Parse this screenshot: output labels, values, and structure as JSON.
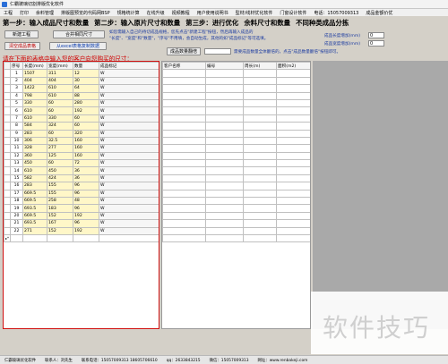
{
  "titlebar": {
    "title": "仁霸玻璃切割排版优化软件"
  },
  "menu": [
    "工程",
    "打印",
    "余料管理",
    "排版图预览的代码网BSP",
    "规格统计算",
    "在线升级",
    "视频教程",
    "用户使用说明书",
    "型材/线材优化软件",
    "门窗设计软件",
    "电话：15057009313",
    "成品金额价优"
  ],
  "steps": [
    "第一步：输入成品尺寸和数量",
    "第二步：输入原片尺寸和数量",
    "第三步：进行优化",
    "余料尺寸和数量",
    "不同种类成品分拣"
  ],
  "buttons": {
    "new_project": "新建工程",
    "merge_size": "合并相同尺寸",
    "clear_table": "清空成品表格",
    "import_excel": "从excel表格复制数据",
    "apply_qty": "成品数量翻倍"
  },
  "instructions": {
    "line1": "如您需输入自己的待切成品规格，您先点击\"新建工程\"按钮，然后再输入成品的",
    "line2": "\"长度\"、\"宽度\"和\"数量\"，\"序号\"不用填，会自动生成，其他的如\"成品标记\"等可选填。",
    "line3": "需要成品数量全体翻倍的，点击\"成品数量翻倍\"按钮即可。"
  },
  "controls": {
    "length_label": "成品长度增加(mm)",
    "length_value": "0",
    "width_label": "成品宽度增加(mm)",
    "width_value": "0"
  },
  "hint": "请在下面的表格中输入您的客户向您购买的尺寸：",
  "grid": {
    "headers": [
      "序号",
      "长度(mm)",
      "宽度(mm)",
      "数量",
      "成品标记"
    ],
    "rows": [
      [
        "1",
        "1507",
        "311",
        "12",
        "W"
      ],
      [
        "2",
        "404",
        "404",
        "30",
        "W"
      ],
      [
        "3",
        "1422",
        "610",
        "64",
        "W"
      ],
      [
        "4",
        "798",
        "610",
        "88",
        "W"
      ],
      [
        "5",
        "330",
        "60",
        "280",
        "W"
      ],
      [
        "6",
        "610",
        "60",
        "192",
        "W"
      ],
      [
        "7",
        "610",
        "330",
        "60",
        "W"
      ],
      [
        "8",
        "584",
        "324",
        "60",
        "W"
      ],
      [
        "9",
        "283",
        "60",
        "320",
        "W"
      ],
      [
        "10",
        "306",
        "32.5",
        "160",
        "W"
      ],
      [
        "11",
        "328",
        "277",
        "160",
        "W"
      ],
      [
        "12",
        "360",
        "125",
        "160",
        "W"
      ],
      [
        "13",
        "450",
        "60",
        "72",
        "W"
      ],
      [
        "14",
        "610",
        "450",
        "36",
        "W"
      ],
      [
        "15",
        "582",
        "424",
        "36",
        "W"
      ],
      [
        "16",
        "283",
        "155",
        "96",
        "W"
      ],
      [
        "17",
        "669.5",
        "155",
        "96",
        "W"
      ],
      [
        "18",
        "669.5",
        "258",
        "48",
        "W"
      ],
      [
        "19",
        "693.5",
        "183",
        "96",
        "W"
      ],
      [
        "20",
        "669.5",
        "152",
        "192",
        "W"
      ],
      [
        "21",
        "693.5",
        "167",
        "96",
        "W"
      ],
      [
        "22",
        "271",
        "152",
        "192",
        "W"
      ]
    ],
    "new_row_marker": "▸*"
  },
  "right_grid": {
    "headers": [
      "客户名称",
      "编号",
      "周长(m)",
      "面积(m2)"
    ]
  },
  "statusbar": {
    "company": "仁霸玻璃优化软件",
    "contact": "联系人：刘先生",
    "phone": "联系电话：15057009313  18605706610",
    "qq": "qq：2633843215",
    "wechat": "微信：15057009313",
    "website": "网址：www.renbakeji.com"
  },
  "watermark": "软件技巧"
}
